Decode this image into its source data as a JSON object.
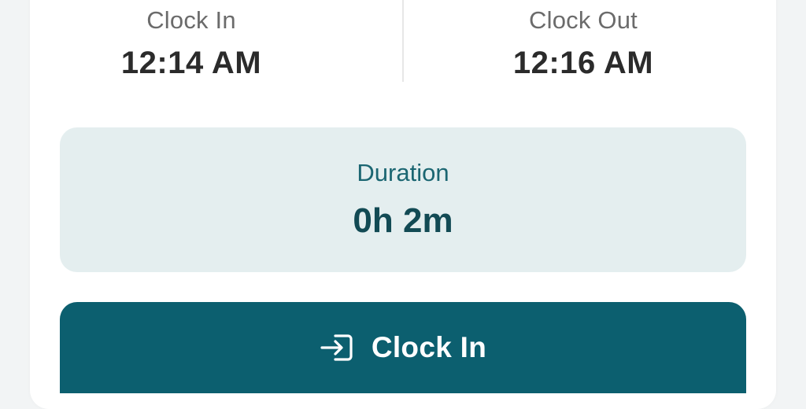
{
  "clock_in": {
    "label": "Clock In",
    "time": "12:14 AM"
  },
  "clock_out": {
    "label": "Clock Out",
    "time": "12:16 AM"
  },
  "duration": {
    "label": "Duration",
    "value": "0h 2m"
  },
  "action_button": {
    "label": "Clock In",
    "icon": "login-arrow-icon"
  },
  "colors": {
    "accent": "#0c5f6f",
    "duration_bg": "#e4eeef",
    "duration_text": "#124a54"
  }
}
